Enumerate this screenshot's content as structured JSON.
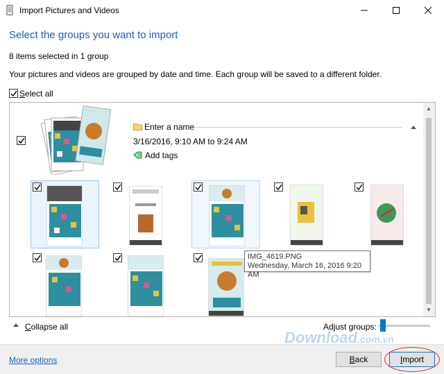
{
  "window": {
    "title": "Import Pictures and Videos",
    "minimize_icon": "minimize-icon",
    "maximize_icon": "maximize-icon",
    "close_icon": "close-icon"
  },
  "heading": "Select the groups you want to import",
  "selection_count": "8 items selected in 1 group",
  "description": "Your pictures and videos are grouped by date and time. Each group will be saved to a different folder.",
  "select_all": {
    "label_u": "S",
    "label_rest": "elect all",
    "checked": true
  },
  "group": {
    "name_placeholder": "Enter a name",
    "date_range": "3/16/2016, 9:10 AM to 9:24 AM",
    "add_tags": "Add tags",
    "checked": true
  },
  "items": [
    {
      "checked": true,
      "style": "game-grid"
    },
    {
      "checked": true,
      "style": "menu-screen"
    },
    {
      "checked": true,
      "style": "game-grid"
    },
    {
      "checked": true,
      "style": "new-gear"
    },
    {
      "checked": true,
      "style": "new-weapon"
    },
    {
      "checked": true,
      "style": "game-grid"
    },
    {
      "checked": true,
      "style": "game-grid"
    },
    {
      "checked": true,
      "style": "congratulations"
    }
  ],
  "tooltip": {
    "filename": "IMG_4619.PNG",
    "datetime": "Wednesday, March 16, 2016 9:20 AM"
  },
  "collapse_all": {
    "u": "C",
    "rest": "ollapse all"
  },
  "adjust_groups": "Adjust groups:",
  "more_options": "More options",
  "back_button": {
    "u": "B",
    "rest": "ack"
  },
  "import_button": {
    "u": "I",
    "rest": "mport"
  },
  "watermark": {
    "main": "Download",
    "sub": ".com.vn"
  },
  "colors": {
    "accent": "#0078d7",
    "heading": "#1a5fb4",
    "highlight_circle": "#e02020"
  }
}
